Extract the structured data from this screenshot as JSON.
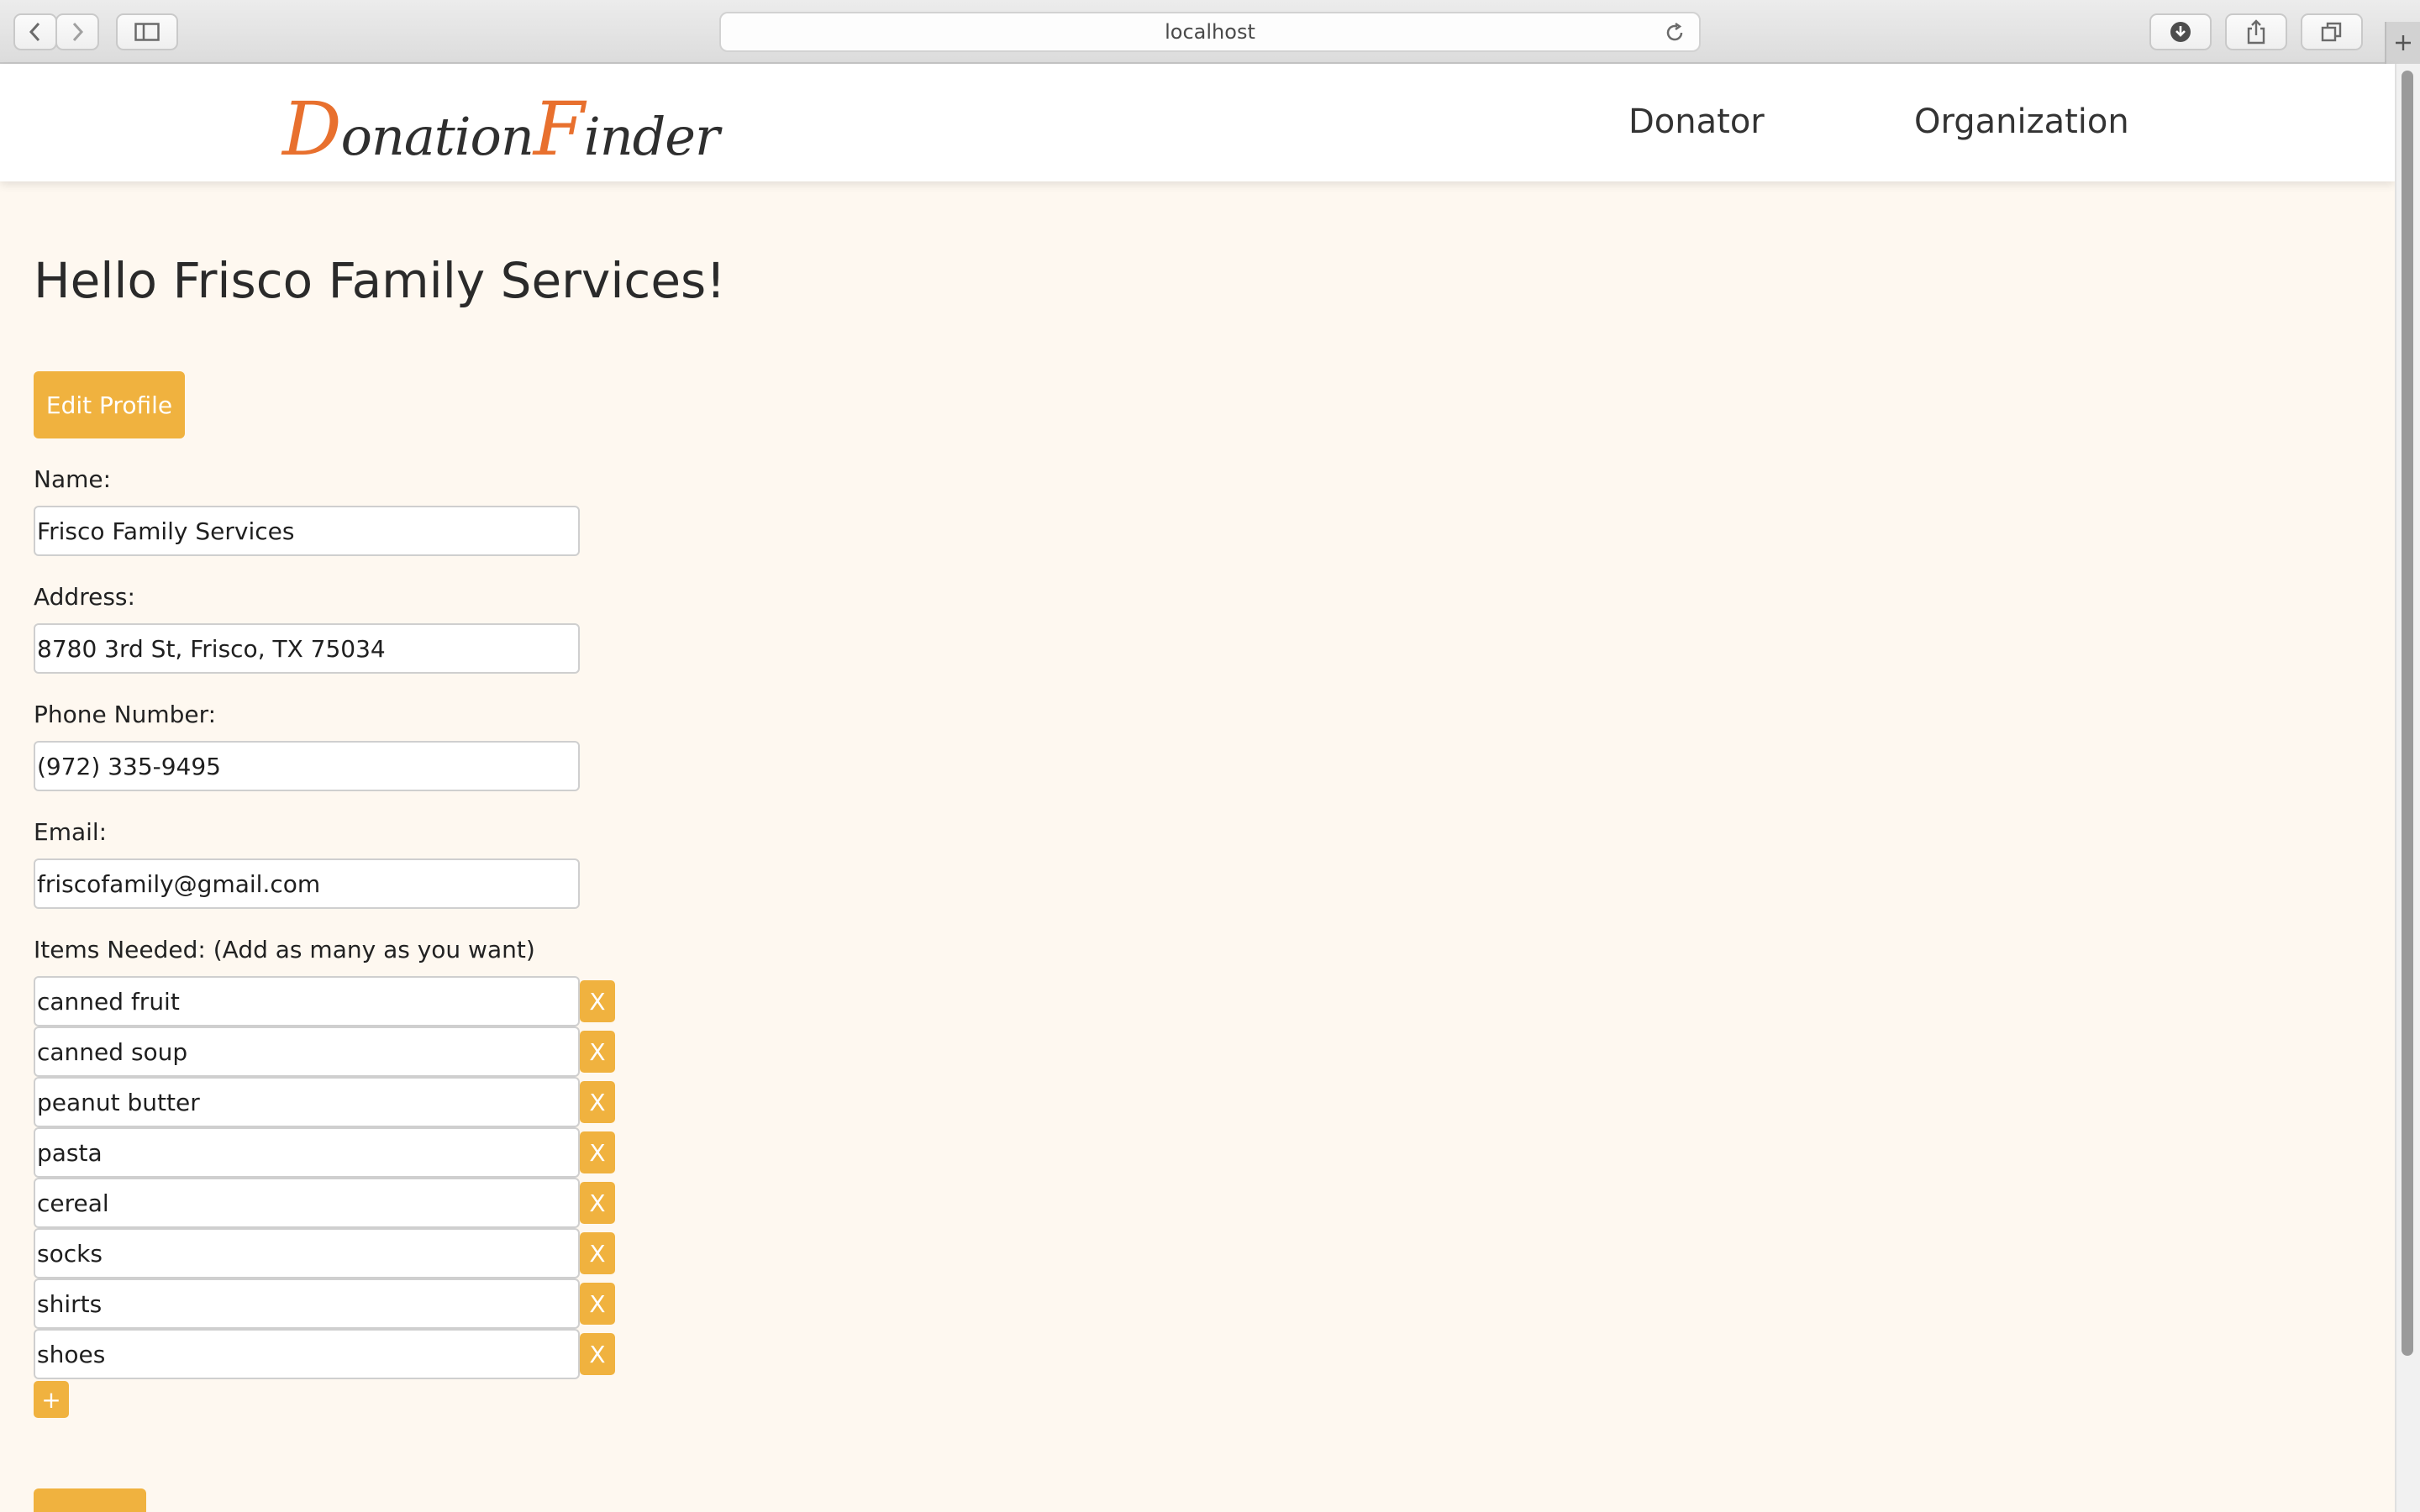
{
  "browser": {
    "url": "localhost"
  },
  "site": {
    "logo_first_cap": "D",
    "logo_first_rest": "onation",
    "logo_second_cap": "F",
    "logo_second_rest": "inder",
    "nav": [
      "Donator",
      "Organization"
    ]
  },
  "page": {
    "greeting": "Hello Frisco Family Services!",
    "edit_profile_label": "Edit Profile",
    "add_item_label": "+"
  },
  "form": {
    "name": {
      "label": "Name:",
      "value": "Frisco Family Services"
    },
    "address": {
      "label": "Address:",
      "value": "8780 3rd St, Frisco, TX 75034"
    },
    "phone": {
      "label": "Phone Number:",
      "value": "(972) 335-9495"
    },
    "email": {
      "label": "Email:",
      "value": "friscofamily@gmail.com"
    },
    "items_label": "Items Needed: (Add as many as you want)",
    "remove_label": "X",
    "items": [
      "canned fruit",
      "canned soup",
      "peanut butter",
      "pasta",
      "cereal",
      "socks",
      "shirts",
      "shoes"
    ]
  },
  "colors": {
    "accent": "#f0b23f",
    "logo_accent": "#e8702e",
    "background": "#fef8f0"
  }
}
